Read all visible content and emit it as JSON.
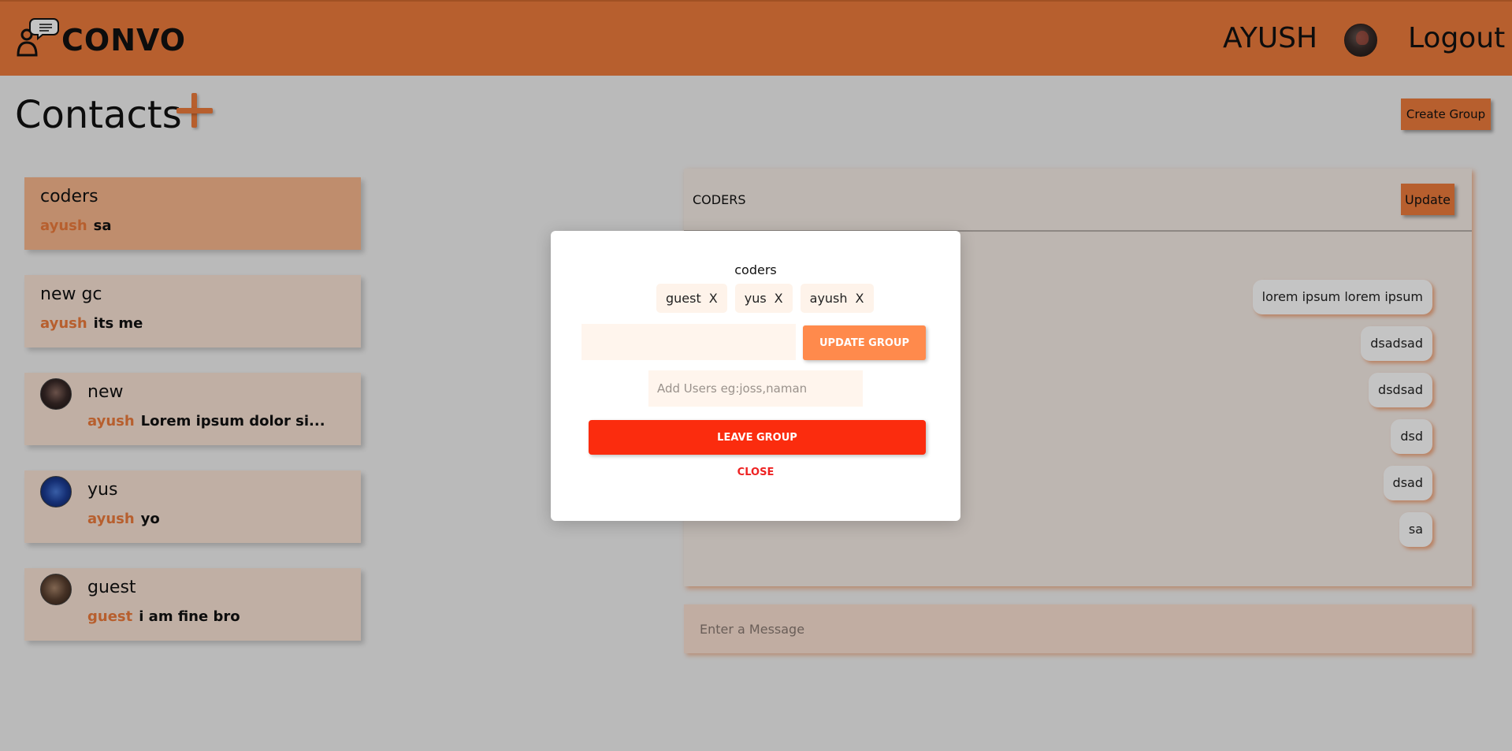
{
  "header": {
    "logo_text": "CONVO",
    "user_name": "AYUSH",
    "logout_label": "Logout",
    "accent_color": "#ee7c3c"
  },
  "contacts": {
    "title": "Contacts",
    "create_group_label": "Create Group",
    "items": [
      {
        "name": "coders",
        "sender": "ayush",
        "message": "sa",
        "active": true,
        "has_avatar": false
      },
      {
        "name": "new gc",
        "sender": "ayush",
        "message": "its me",
        "active": false,
        "has_avatar": false
      },
      {
        "name": "new",
        "sender": "ayush",
        "message": "Lorem ipsum dolor si...",
        "active": false,
        "has_avatar": true
      },
      {
        "name": "yus",
        "sender": "ayush",
        "message": "yo",
        "active": false,
        "has_avatar": true
      },
      {
        "name": "guest",
        "sender": "guest",
        "message": "i am fine bro",
        "active": false,
        "has_avatar": true
      }
    ]
  },
  "chat": {
    "title": "CODERS",
    "update_label": "Update",
    "messages": [
      "lorem ipsum lorem ipsum",
      "dsadsad",
      "dsdsad",
      "dsd",
      "dsad",
      "sa"
    ],
    "input_placeholder": "Enter a Message"
  },
  "modal": {
    "title": "coders",
    "members": [
      "guest",
      "yus",
      "ayush"
    ],
    "remove_label": "X",
    "rename_value": "",
    "update_group_label": "UPDATE GROUP",
    "add_users_placeholder": "Add Users eg:joss,naman",
    "leave_label": "LEAVE GROUP",
    "close_label": "CLOSE"
  },
  "colors": {
    "accent": "#ee7c3c",
    "danger": "#fb2c0e",
    "update_button": "#ff8a4c"
  }
}
